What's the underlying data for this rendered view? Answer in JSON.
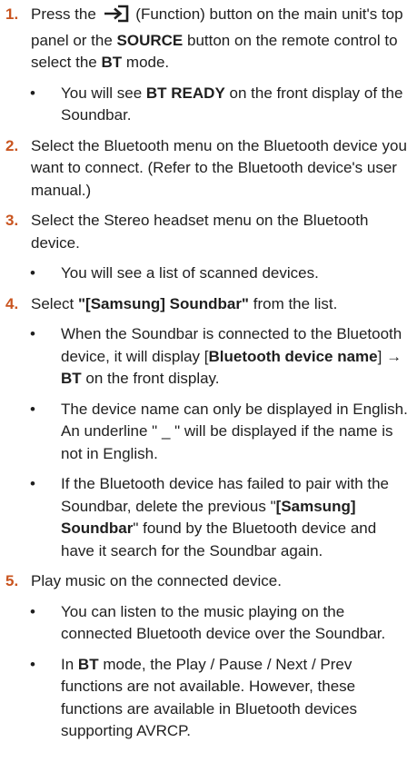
{
  "steps": [
    {
      "number": "1.",
      "parts": {
        "a": "Press the",
        "b": "(Function) button on the main unit's top panel or the",
        "c": "SOURCE",
        "d": "button on the remote control to select the",
        "e": "BT",
        "f": "mode."
      },
      "bullets": [
        {
          "a": "You will see",
          "b": "BT READY",
          "c": "on the front display of the Soundbar."
        }
      ],
      "icon": "function-input-icon"
    },
    {
      "number": "2.",
      "text": "Select the Bluetooth menu on the Bluetooth device you want to connect. (Refer to the Bluetooth device's user manual.)"
    },
    {
      "number": "3.",
      "text": "Select the Stereo headset menu on the Bluetooth device.",
      "bullets": [
        {
          "text": "You will see a list of scanned devices."
        }
      ]
    },
    {
      "number": "4.",
      "parts": {
        "a": "Select",
        "b": "\"[Samsung] Soundbar\"",
        "c": "from the list."
      },
      "bullets": [
        {
          "a": "When the Soundbar is connected to the Bluetooth device, it will display [",
          "b": "Bluetooth device name",
          "c": "] →",
          "d": "BT",
          "e": "on the front display."
        },
        {
          "text": "The device name can only be displayed in English. An underline \" _ \" will be displayed if the name is not in English."
        },
        {
          "a": "If the Bluetooth device has failed to pair with the Soundbar, delete the previous \"",
          "b": "[Samsung] Soundbar",
          "c": "\" found by the Bluetooth device and have it search for the Soundbar again."
        }
      ]
    },
    {
      "number": "5.",
      "text": "Play music on the connected device.",
      "bullets": [
        {
          "text": "You can listen to the music playing on the connected Bluetooth device over the Soundbar."
        },
        {
          "a": "In",
          "b": "BT",
          "c": "mode, the Play / Pause / Next / Prev functions are not available. However, these functions are available in Bluetooth devices supporting AVRCP."
        }
      ]
    }
  ],
  "bullet_glyph": "•",
  "accent_color": "#c9541f"
}
